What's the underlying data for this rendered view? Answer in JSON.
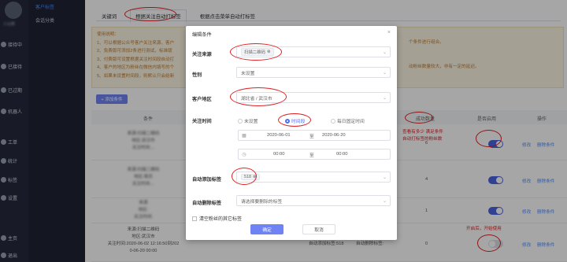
{
  "sidebar": {
    "items": [
      {
        "label": "接待中",
        "icon": "chat-icon"
      },
      {
        "label": "已接待",
        "icon": "chat-done-icon"
      },
      {
        "label": "已过期",
        "icon": "clock-icon"
      },
      {
        "label": "机器人",
        "icon": "robot-icon"
      },
      {
        "label": "工单",
        "icon": "ticket-icon"
      },
      {
        "label": "统计",
        "icon": "chart-icon"
      },
      {
        "label": "标签",
        "icon": "tag-icon"
      },
      {
        "label": "设置",
        "icon": "gear-icon"
      },
      {
        "label": "主页",
        "icon": "home-icon"
      },
      {
        "label": "退出",
        "icon": "logout-icon"
      }
    ],
    "sub_items": [
      {
        "label": "客户标签",
        "active": true
      },
      {
        "label": "会话分类",
        "active": false
      }
    ]
  },
  "tabs": [
    {
      "label": "关键词",
      "active": false
    },
    {
      "label": "根据关注自动打标签",
      "active": true
    },
    {
      "label": "根据点击菜单自动打标签",
      "active": false
    }
  ],
  "notice": {
    "lines": [
      "使用说明：",
      "1、可以根据公众号客户关注来源、客户",
      "2、免费版可添加2条进行测试，标准版",
      "3、付费版可设置根据关注时间段自动打",
      "4、客户的地区为粉丝在微信内填写的个",
      "5、如果未设置时间段，则默认只会给新"
    ],
    "right_1": "个条件进行组合。",
    "right_2": "动粉丝数量较大，非有一定的延迟。"
  },
  "add_button": "+ 添加条件",
  "table": {
    "headers": [
      "条件",
      "",
      "",
      "成功数量",
      "是否启用",
      "操作"
    ],
    "rows": [
      {
        "cond": [
          "来源:扫描二维码",
          "地区:武汉市",
          "关注时间:..."
        ],
        "tag": "",
        "count": "6",
        "enabled": true
      },
      {
        "cond": [
          "来源:扫描二维码",
          "地区:南京",
          "关注时间:..."
        ],
        "tag": "",
        "count": "4",
        "enabled": true
      },
      {
        "cond": [
          "来源",
          "地区:",
          "关注时间:"
        ],
        "tag": "",
        "count": "1",
        "enabled": true
      },
      {
        "cond": [
          "来源:扫描二维码",
          "地区:武汉市",
          "关注时间:2020-06-02 12:16:50到202",
          "0-06-20 00:00"
        ],
        "tag": "自动添加标签:518",
        "tag2": "自动删除标签:",
        "count": "0",
        "enabled": false
      }
    ],
    "edit_label": "修改",
    "delete_label": "删除条件"
  },
  "annotations": {
    "success_note": "查看有多少 满足条件\n自动打标签的粉丝数",
    "enable_note": "开启后，开始使用"
  },
  "modal": {
    "title": "编辑条件",
    "close": "×",
    "source_label": "关注来源",
    "source_value": "扫描二维码",
    "gender_label": "性别",
    "gender_placeholder": "未设置",
    "region_label": "客户地区",
    "region_value": "湖北省 / 武汉市",
    "time_label": "关注时间",
    "time_options": [
      {
        "label": "未设置",
        "on": false
      },
      {
        "label": "时间段",
        "on": true
      },
      {
        "label": "每日固定时间",
        "on": false
      }
    ],
    "date_start": "2020-06-01",
    "date_end": "2020-06-20",
    "time_start": "00:00",
    "time_end": "00:00",
    "to": "至",
    "add_tag_label": "自动添加标签",
    "add_tag_value": "518",
    "remove_tag_label": "自动删除标签",
    "remove_tag_placeholder": "请选择要删除的标签",
    "clear_label": "清空粉丝的其它标签",
    "ok": "确定",
    "cancel": "取消"
  },
  "colors": {
    "accent": "#4e6ef2",
    "annotation": "#e02020",
    "sidebar": "#252a3d"
  }
}
